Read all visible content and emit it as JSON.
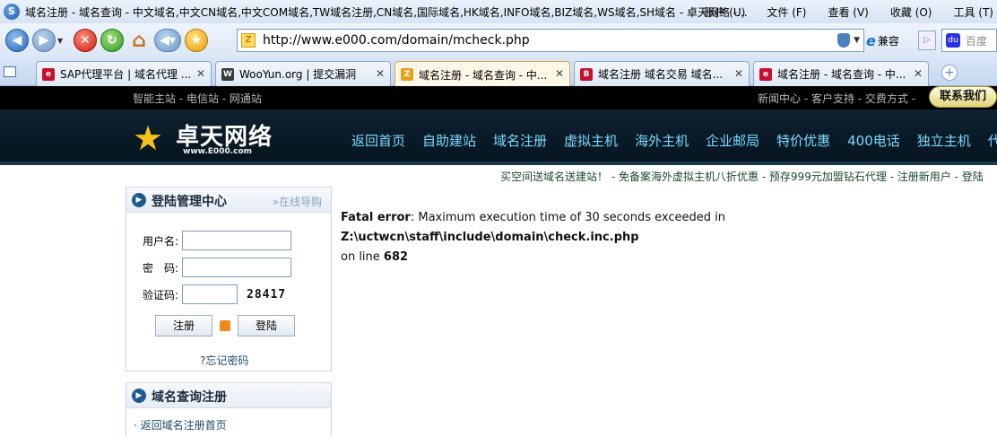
{
  "browser": {
    "window_title": "域名注册 - 域名查询 - 中文域名,中文CN域名,中文COM域名,TW域名注册,CN域名,国际域名,HK域名,INFO域名,BIZ域名,WS域名,SH域名 - 卓天网络 -...",
    "menu": [
      "账户 (U)",
      "文件 (F)",
      "查看 (V)",
      "收藏 (O)",
      "工具 (T)"
    ],
    "address": "http://www.e000.com/domain/mcheck.php",
    "compat_label": "兼容",
    "search_placeholder": "百度",
    "tabs": [
      {
        "label": "SAP代理平台 | 域名代理 ...",
        "favicon": "e",
        "color": "#c8102e"
      },
      {
        "label": "WooYun.org | 提交漏洞",
        "favicon": "W",
        "color": "#3a3a3a"
      },
      {
        "label": "域名注册 - 域名查询 - 中...",
        "favicon": "Z",
        "color": "#e6a019"
      },
      {
        "label": "域名注册 域名交易 域名...",
        "favicon": "B",
        "color": "#c8102e"
      },
      {
        "label": "域名注册 - 域名查询 - 中...",
        "favicon": "e",
        "color": "#c8102e"
      }
    ]
  },
  "site": {
    "top_left": "智能主站 - 电信站 - 网通站",
    "top_right": "新闻中心 - 客户支持 - 交费方式 -",
    "contact": "联系我们",
    "logo": "卓天网络",
    "logo_sub": "www.E000.com",
    "nav": [
      "返回首页",
      "自助建站",
      "域名注册",
      "虚拟主机",
      "海外主机",
      "企业邮局",
      "特价优惠",
      "400电话",
      "独立主机",
      "代理加盟"
    ],
    "promo": "买空间送域名送建站！ - 免备案海外虚拟主机八折优惠 - 预存999元加盟钻石代理 - 注册新用户 - 登陆"
  },
  "login": {
    "title": "登陆管理中心",
    "guide": "»在线导购",
    "username_label": "用户名:",
    "password_label": "密　码:",
    "captcha_label": "验证码:",
    "captcha_value": "28417",
    "register_btn": "注册",
    "login_btn": "登陆",
    "forgot": "?忘记密码"
  },
  "domain_panel": {
    "title": "域名查询注册",
    "item": "· 返回域名注册首页"
  },
  "error": {
    "label": "Fatal error",
    "message": ": Maximum execution time of 30 seconds exceeded in ",
    "path": "Z:\\uctwcn\\staff\\include\\domain\\check.inc.php",
    "online": " on line ",
    "line": "682"
  }
}
